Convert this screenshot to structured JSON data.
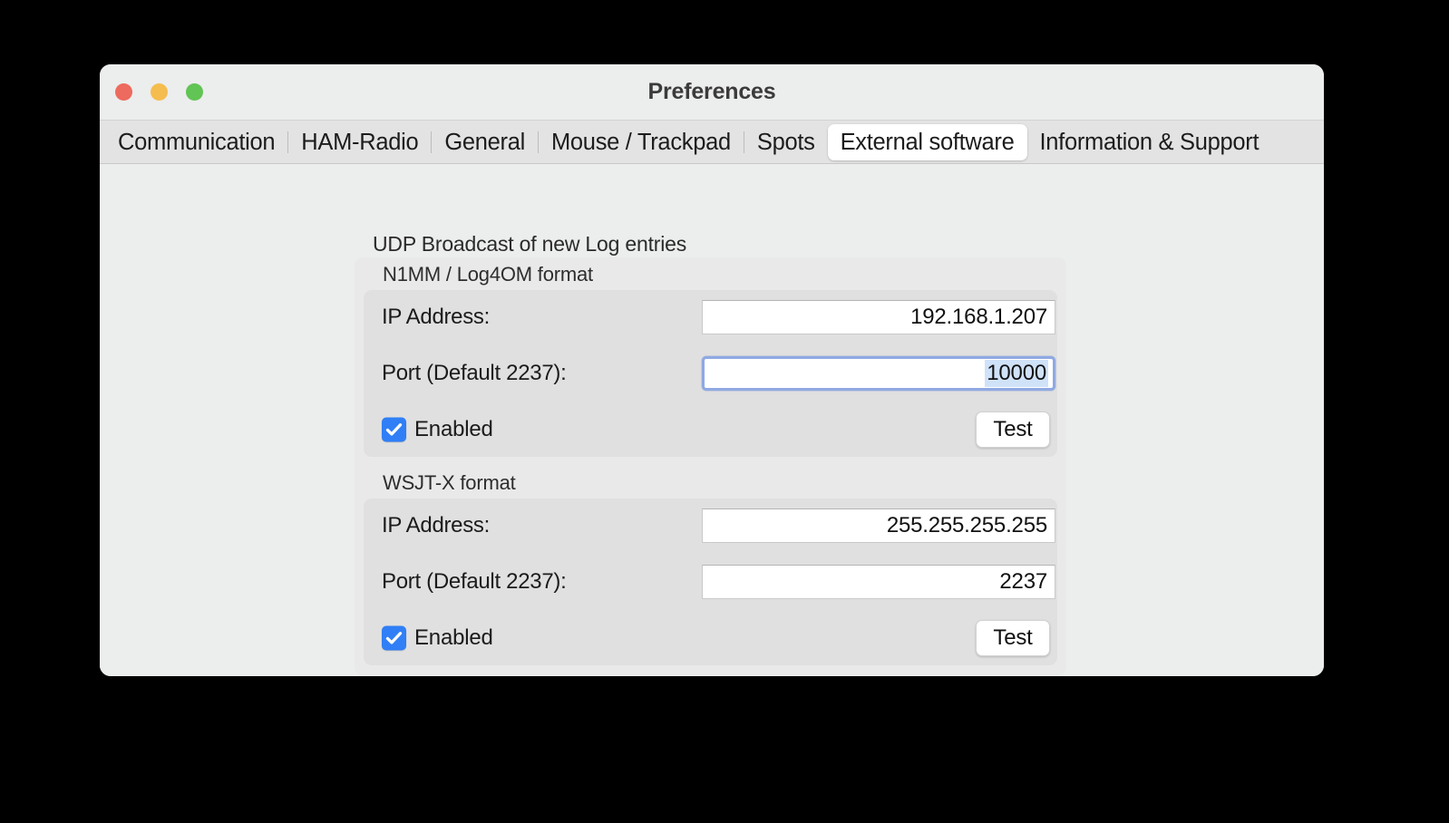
{
  "window": {
    "title": "Preferences",
    "traffic_lights": [
      {
        "name": "close",
        "color": "#ed6a5e"
      },
      {
        "name": "minimize",
        "color": "#f5bd4f"
      },
      {
        "name": "maximize",
        "color": "#61c454"
      }
    ]
  },
  "tabs": [
    {
      "label": "Communication",
      "active": false
    },
    {
      "label": "HAM-Radio",
      "active": false
    },
    {
      "label": "General",
      "active": false
    },
    {
      "label": "Mouse / Trackpad",
      "active": false
    },
    {
      "label": "Spots",
      "active": false
    },
    {
      "label": "External software",
      "active": true
    },
    {
      "label": "Information & Support",
      "active": false
    }
  ],
  "main": {
    "section_title": "UDP Broadcast of new Log entries",
    "groups": [
      {
        "label": "N1MM / Log4OM format",
        "ip_label": "IP Address:",
        "ip_value": "192.168.1.207",
        "port_label": "Port (Default 2237):",
        "port_value": "10000",
        "port_focused": true,
        "enabled_label": "Enabled",
        "enabled_checked": true,
        "test_label": "Test"
      },
      {
        "label": "WSJT-X format",
        "ip_label": "IP Address:",
        "ip_value": "255.255.255.255",
        "port_label": "Port (Default 2237):",
        "port_value": "2237",
        "port_focused": false,
        "enabled_label": "Enabled",
        "enabled_checked": true,
        "test_label": "Test"
      }
    ]
  },
  "colors": {
    "accent": "#307ff6",
    "focus_ring": "#8fa9e2",
    "selection": "#cfe2f8",
    "window_bg": "#eceded",
    "tabbar_bg": "#e3e3e3"
  }
}
